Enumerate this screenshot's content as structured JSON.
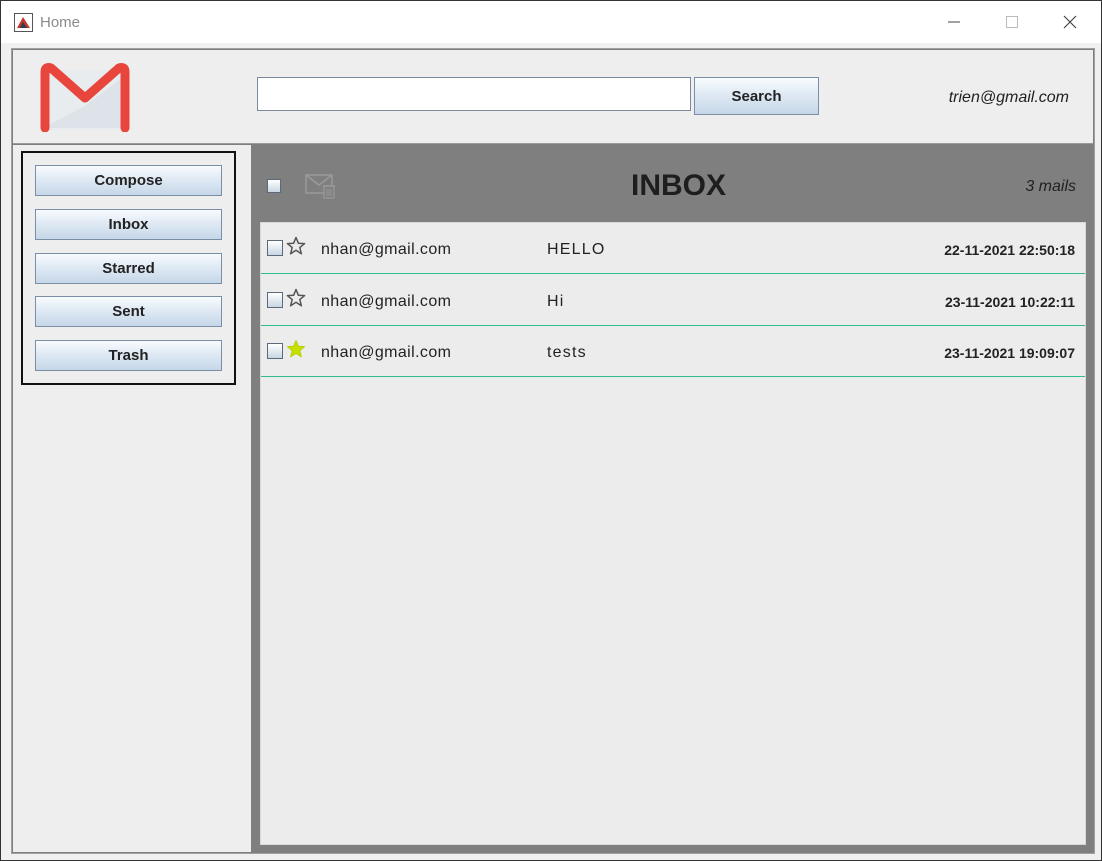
{
  "window": {
    "title": "Home"
  },
  "header": {
    "search_value": "",
    "search_label": "Search",
    "user_email": "trien@gmail.com"
  },
  "sidebar": {
    "items": [
      {
        "label": "Compose"
      },
      {
        "label": "Inbox"
      },
      {
        "label": "Starred"
      },
      {
        "label": "Sent"
      },
      {
        "label": "Trash"
      }
    ]
  },
  "inbox": {
    "title": "INBOX",
    "count_label": "3 mails",
    "emails": [
      {
        "from": "nhan@gmail.com",
        "subject": "HELLO",
        "date": "22-11-2021 22:50:18",
        "starred": false
      },
      {
        "from": "nhan@gmail.com",
        "subject": "Hi",
        "date": "23-11-2021 10:22:11",
        "starred": false
      },
      {
        "from": "nhan@gmail.com",
        "subject": "tests",
        "date": "23-11-2021 19:09:07",
        "starred": true
      }
    ]
  },
  "colors": {
    "star_active": "#c8e000",
    "row_divider": "#2fc08a",
    "logo_red": "#e8453c"
  }
}
